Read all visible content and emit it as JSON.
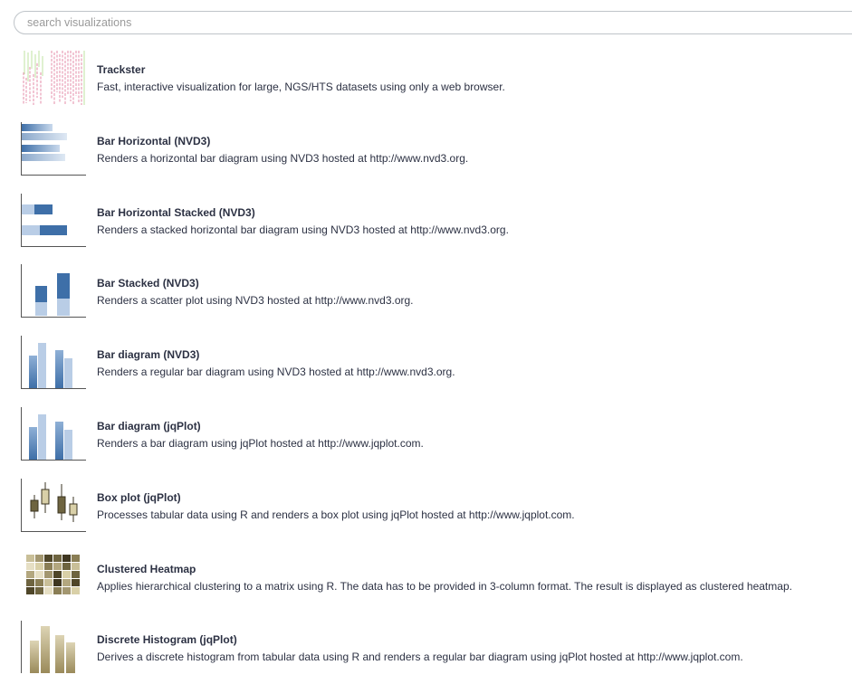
{
  "search": {
    "placeholder": "search visualizations"
  },
  "visualizations": [
    {
      "title": "Trackster",
      "description": "Fast, interactive visualization for large, NGS/HTS datasets using only a web browser.",
      "icon": "trackster-thumbnail"
    },
    {
      "title": "Bar Horizontal (NVD3)",
      "description": "Renders a horizontal bar diagram using NVD3 hosted at http://www.nvd3.org.",
      "icon": "bar-horizontal-thumbnail"
    },
    {
      "title": "Bar Horizontal Stacked (NVD3)",
      "description": "Renders a stacked horizontal bar diagram using NVD3 hosted at http://www.nvd3.org.",
      "icon": "bar-horizontal-stacked-thumbnail"
    },
    {
      "title": "Bar Stacked (NVD3)",
      "description": "Renders a scatter plot using NVD3 hosted at http://www.nvd3.org.",
      "icon": "bar-stacked-thumbnail"
    },
    {
      "title": "Bar diagram (NVD3)",
      "description": "Renders a regular bar diagram using NVD3 hosted at http://www.nvd3.org.",
      "icon": "bar-diagram-thumbnail"
    },
    {
      "title": "Bar diagram (jqPlot)",
      "description": "Renders a bar diagram using jqPlot hosted at http://www.jqplot.com.",
      "icon": "bar-diagram-thumbnail"
    },
    {
      "title": "Box plot (jqPlot)",
      "description": "Processes tabular data using R and renders a box plot using jqPlot hosted at http://www.jqplot.com.",
      "icon": "box-plot-thumbnail"
    },
    {
      "title": "Clustered Heatmap",
      "description": "Applies hierarchical clustering to a matrix using R. The data has to be provided in 3-column format. The result is displayed as clustered heatmap.",
      "icon": "heatmap-thumbnail"
    },
    {
      "title": "Discrete Histogram (jqPlot)",
      "description": "Derives a discrete histogram from tabular data using R and renders a regular bar diagram using jqPlot hosted at http://www.jqplot.com.",
      "icon": "histogram-thumbnail"
    }
  ],
  "colors": {
    "blue": "#3e6fa8",
    "blue_light": "#b9cde6",
    "tan": "#9a8a5a",
    "pink": "#e8a0b8",
    "green": "#bfe3a0"
  }
}
